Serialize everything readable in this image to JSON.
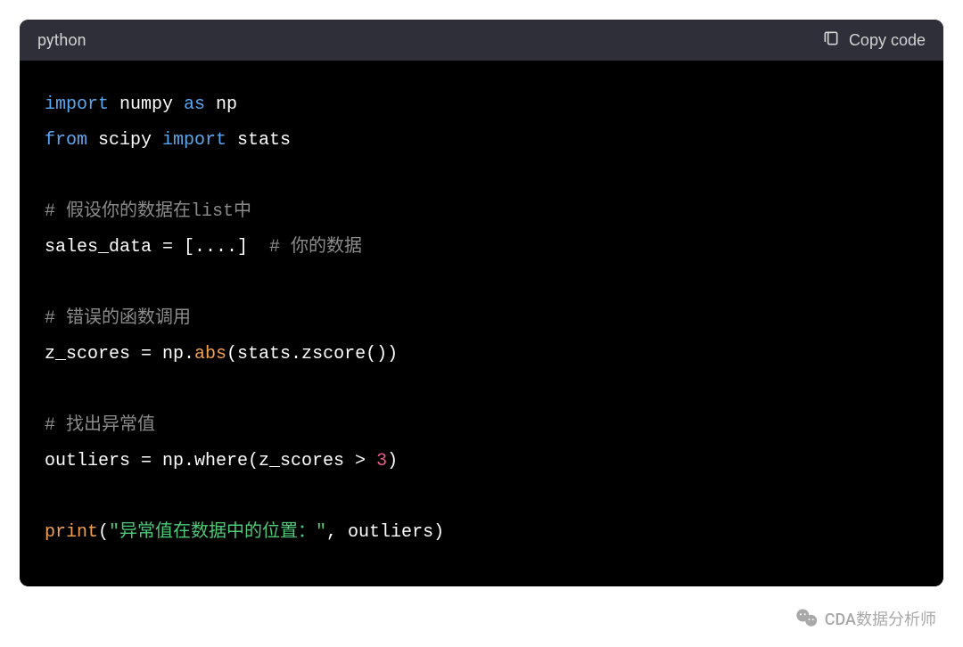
{
  "header": {
    "language": "python",
    "copy_label": "Copy code"
  },
  "code": {
    "line1_kw1": "import",
    "line1_mod": " numpy ",
    "line1_kw2": "as",
    "line1_alias": " np",
    "line2_kw1": "from",
    "line2_mod": " scipy ",
    "line2_kw2": "import",
    "line2_name": " stats",
    "line3_comment": "# 假设你的数据在list中",
    "line4_code": "sales_data = [....]  ",
    "line4_comment": "# 你的数据",
    "line5_comment": "# 错误的函数调用",
    "line6_a": "z_scores = np.",
    "line6_fn": "abs",
    "line6_b": "(stats.zscore())",
    "line7_comment": "# 找出异常值",
    "line8_a": "outliers = np.where(z_scores > ",
    "line8_num": "3",
    "line8_b": ")",
    "line9_fn": "print",
    "line9_a": "(",
    "line9_str": "\"异常值在数据中的位置：\"",
    "line9_b": ", outliers)"
  },
  "watermark": {
    "text": "CDA数据分析师"
  }
}
